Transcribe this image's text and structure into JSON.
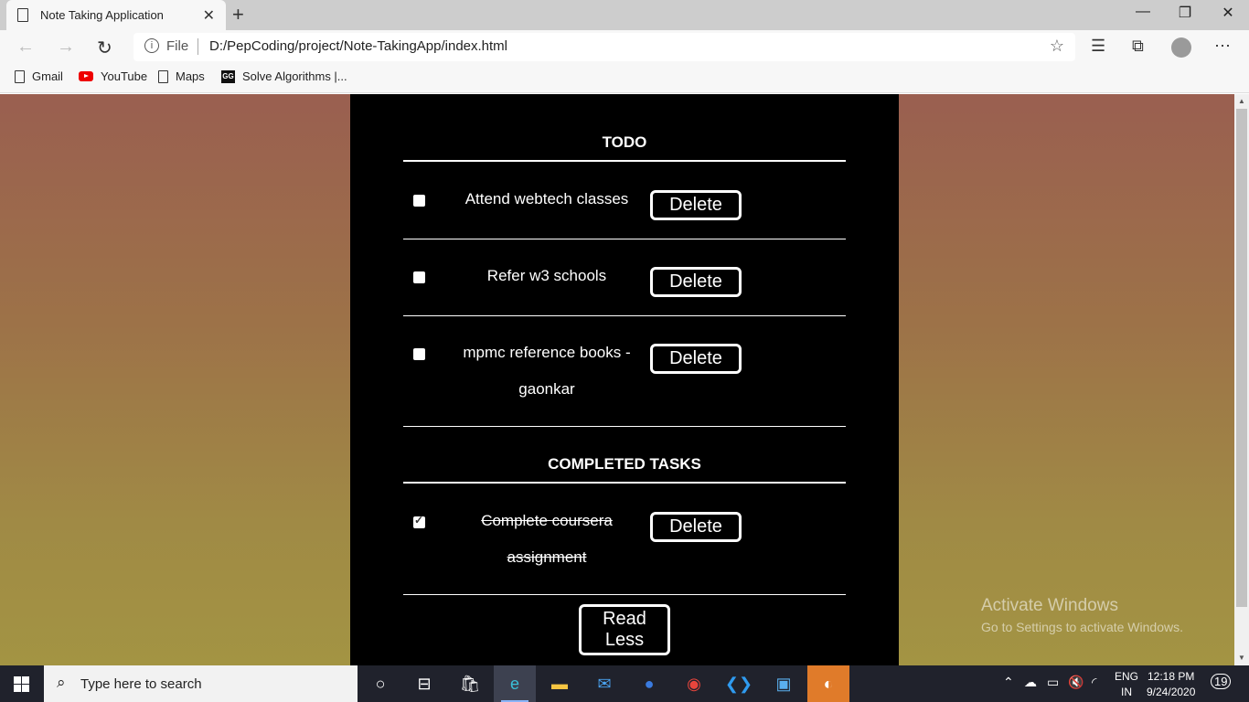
{
  "browser": {
    "tab_title": "Note Taking Application",
    "tab_close": "✕",
    "new_tab": "+",
    "window": {
      "minimize": "—",
      "restore": "❐",
      "close": "✕"
    },
    "address": {
      "file_label": "File",
      "url": "D:/PepCoding/project/Note-TakingApp/index.html"
    },
    "bookmarks": [
      {
        "label": "Gmail",
        "icon": "page-icon"
      },
      {
        "label": "YouTube",
        "icon": "youtube-icon"
      },
      {
        "label": "Maps",
        "icon": "page-icon"
      },
      {
        "label": "Solve Algorithms |...",
        "icon": "gfg-icon"
      }
    ]
  },
  "app": {
    "todo_title": "TODO",
    "todo_items": [
      {
        "text": "Attend webtech classes",
        "checked": false,
        "delete_label": "Delete"
      },
      {
        "text": "Refer w3 schools",
        "checked": false,
        "delete_label": "Delete"
      },
      {
        "text": "mpmc reference books - gaonkar",
        "checked": false,
        "delete_label": "Delete"
      }
    ],
    "completed_title": "COMPLETED TASKS",
    "completed_items": [
      {
        "text": "Complete coursera assignment",
        "checked": true,
        "delete_label": "Delete"
      }
    ],
    "read_less_label": "Read Less",
    "colors": {
      "panel_bg": "#000000",
      "text": "#ffffff",
      "bg_top": "#9a5f50",
      "bg_bottom": "#a39443"
    }
  },
  "watermark": {
    "line1": "Activate Windows",
    "line2": "Go to Settings to activate Windows."
  },
  "taskbar": {
    "search_placeholder": "Type here to search",
    "language": {
      "line1": "ENG",
      "line2": "IN"
    },
    "time": "12:18 PM",
    "date": "9/24/2020",
    "notifications": "19"
  }
}
